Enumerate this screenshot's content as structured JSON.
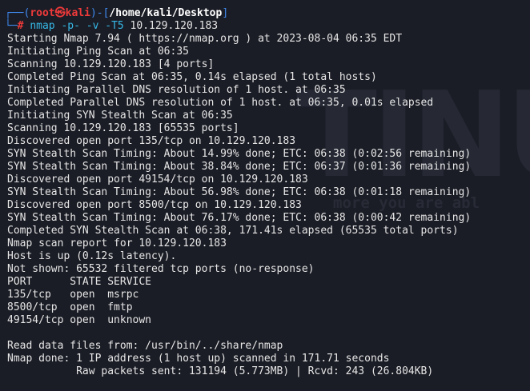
{
  "prompt": {
    "corner_top": "┌──(",
    "user": "root㉿kali",
    "close_paren": ")-[",
    "path": "/home/kali/Desktop",
    "close_bracket": "]",
    "corner_bottom": "└─",
    "symbol": "# "
  },
  "command": {
    "tool": "nmap",
    "flags": " -p- -v -T5 ",
    "target": "10.129.120.183"
  },
  "watermark": {
    "big_text": "TINU",
    "small_text": "more you are abl"
  },
  "output_lines": [
    "Starting Nmap 7.94 ( https://nmap.org ) at 2023-08-04 06:35 EDT",
    "Initiating Ping Scan at 06:35",
    "Scanning 10.129.120.183 [4 ports]",
    "Completed Ping Scan at 06:35, 0.14s elapsed (1 total hosts)",
    "Initiating Parallel DNS resolution of 1 host. at 06:35",
    "Completed Parallel DNS resolution of 1 host. at 06:35, 0.01s elapsed",
    "Initiating SYN Stealth Scan at 06:35",
    "Scanning 10.129.120.183 [65535 ports]",
    "Discovered open port 135/tcp on 10.129.120.183",
    "SYN Stealth Scan Timing: About 14.99% done; ETC: 06:38 (0:02:56 remaining)",
    "SYN Stealth Scan Timing: About 38.84% done; ETC: 06:37 (0:01:36 remaining)",
    "Discovered open port 49154/tcp on 10.129.120.183",
    "SYN Stealth Scan Timing: About 56.98% done; ETC: 06:38 (0:01:18 remaining)",
    "Discovered open port 8500/tcp on 10.129.120.183",
    "SYN Stealth Scan Timing: About 76.17% done; ETC: 06:38 (0:00:42 remaining)",
    "Completed SYN Stealth Scan at 06:38, 171.41s elapsed (65535 total ports)",
    "Nmap scan report for 10.129.120.183",
    "Host is up (0.12s latency).",
    "Not shown: 65532 filtered tcp ports (no-response)",
    "PORT      STATE SERVICE",
    "135/tcp   open  msrpc",
    "8500/tcp  open  fmtp",
    "49154/tcp open  unknown",
    "",
    "Read data files from: /usr/bin/../share/nmap",
    "Nmap done: 1 IP address (1 host up) scanned in 171.71 seconds",
    "           Raw packets sent: 131194 (5.773MB) | Rcvd: 243 (26.804KB)"
  ]
}
